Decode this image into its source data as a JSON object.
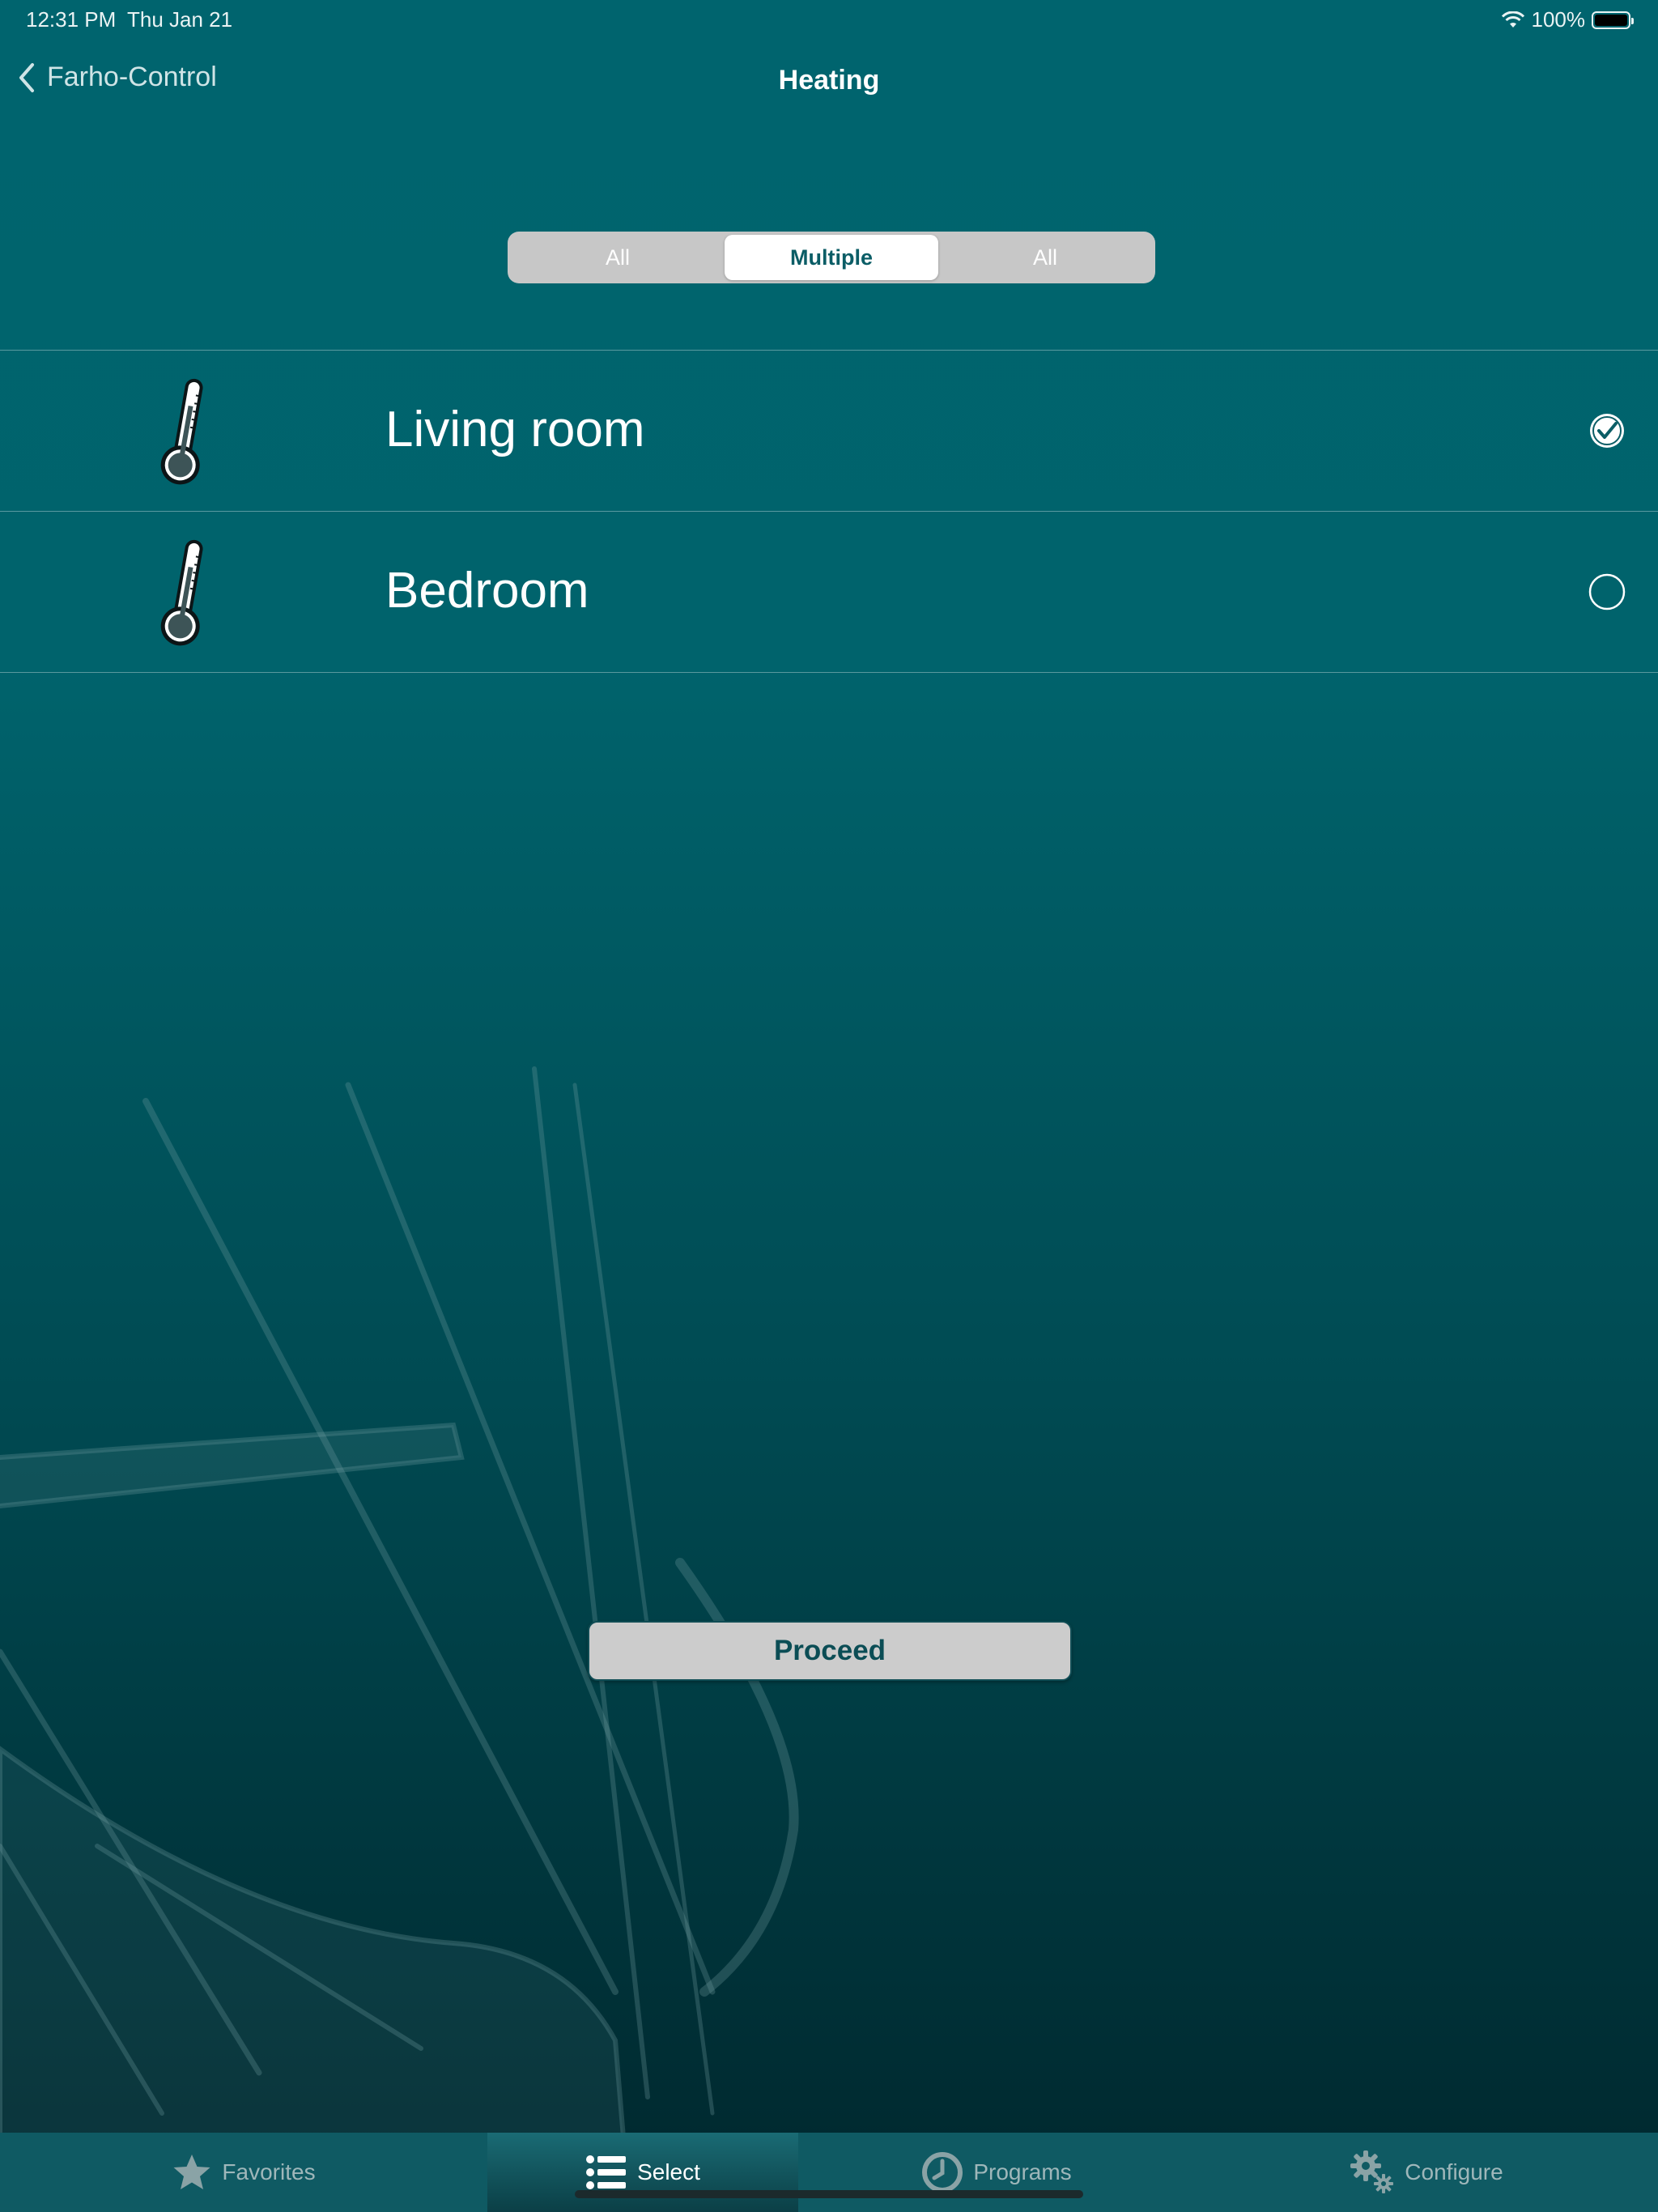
{
  "status_bar": {
    "time": "12:31 PM",
    "date": "Thu Jan 21",
    "battery": "100%"
  },
  "nav": {
    "back_label": "Farho-Control",
    "title": "Heating"
  },
  "segmented": {
    "options": [
      "All",
      "Multiple",
      "All"
    ],
    "selected": "Multiple"
  },
  "rooms": [
    {
      "name": "Living room",
      "selected": true
    },
    {
      "name": "Bedroom",
      "selected": false
    }
  ],
  "proceed_label": "Proceed",
  "tabs": [
    {
      "label": "Favorites",
      "icon": "star-icon",
      "active": false
    },
    {
      "label": "Select",
      "icon": "list-icon",
      "active": true
    },
    {
      "label": "Programs",
      "icon": "clock-icon",
      "active": false
    },
    {
      "label": "Configure",
      "icon": "gear-icon",
      "active": false
    }
  ],
  "colors": {
    "background_top": "#00646e",
    "background_bottom": "#00272d",
    "accent": "#0b5d66",
    "tabbar": "#0f5a63"
  }
}
